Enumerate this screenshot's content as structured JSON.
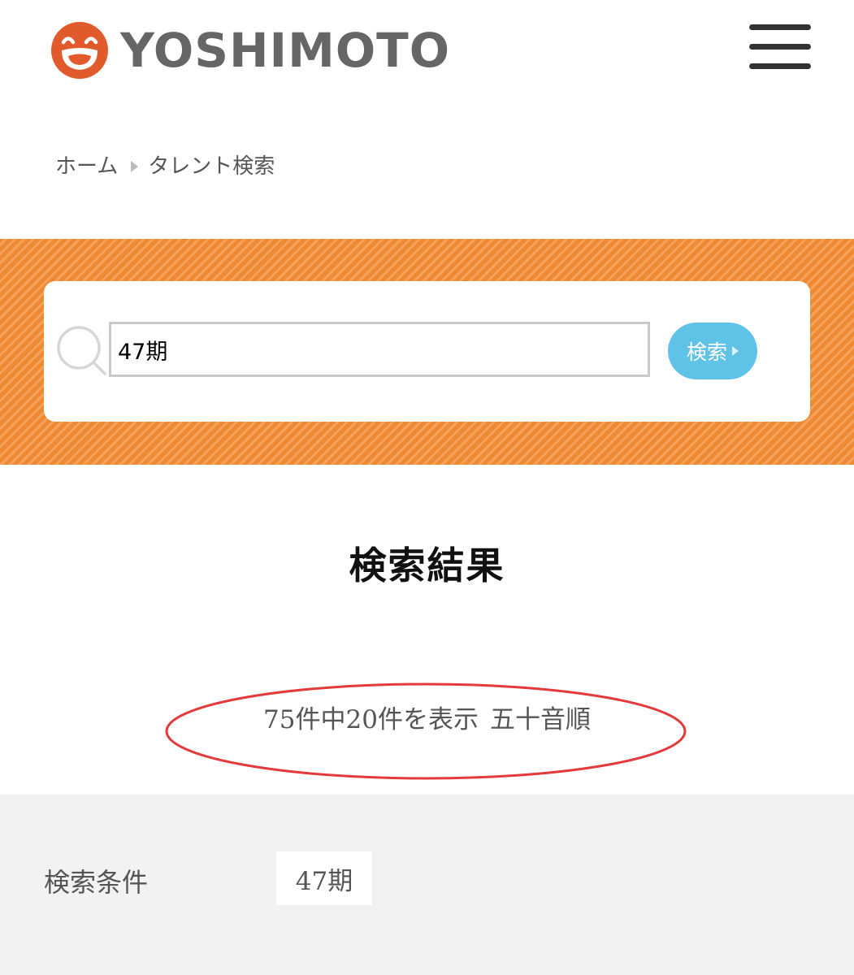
{
  "header": {
    "logo_text": "YOSHIMOTO",
    "brand_color": "#e05a2b",
    "menu_icon": "hamburger-menu-icon"
  },
  "breadcrumb": {
    "items": [
      "ホーム",
      "タレント検索"
    ],
    "separator_icon": "triangle-right-icon"
  },
  "search": {
    "band_color": "#ef8a33",
    "query": "47期",
    "button_label": "検索",
    "button_color": "#5fc3e8",
    "icon": "search-icon"
  },
  "results": {
    "title": "検索結果",
    "summary": "75件中20件を表示",
    "sort_label": "五十音順",
    "highlight_color": "#e33b3b"
  },
  "conditions": {
    "label": "検索条件",
    "value": "47期"
  }
}
